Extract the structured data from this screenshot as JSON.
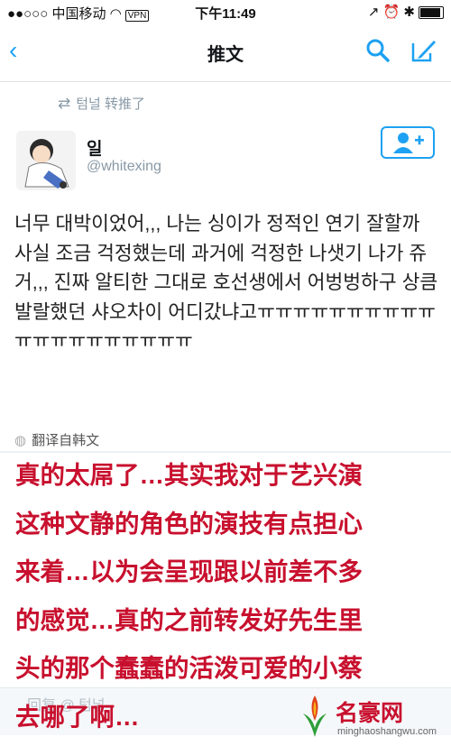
{
  "status_bar": {
    "carrier": "●●○○○ 中国移动",
    "vpn": "VPN",
    "time": "下午11:49",
    "right_icons": "↗ ⏰ ✱"
  },
  "nav": {
    "back_glyph": "‹",
    "title": "推文"
  },
  "retweet": {
    "user": "텀널",
    "action": "转推了"
  },
  "tweet": {
    "display_name": "일",
    "handle": "@whitexing",
    "text": "너무 대박이었어,,, 나는 싱이가 정적인 연기 잘할까 사실 조금 걱정했는데 과거에 걱정한 나샛기 나가 쥬거,,, 진짜 알티한 그대로 호선생에서 어벙벙하구 상큼발랄했던 샤오차이 어디갔냐고ㅠㅠㅠㅠㅠㅠㅠㅠㅠㅠㅠㅠㅠㅠㅠㅠㅠㅠㅠㅠ",
    "translate_label": "翻译自韩文"
  },
  "reply": {
    "placeholder": "回复 @ 텀널"
  },
  "overlay": {
    "lines": [
      "真的太屌了…其实我对于艺兴演",
      "这种文静的角色的演技有点担心",
      "来着…以为会呈现跟以前差不多",
      "的感觉…真的之前转发好先生里",
      "头的那个蠢蠢的活泼可爱的小蔡",
      "去哪了啊…"
    ],
    "color": "#c8102e"
  },
  "watermark": {
    "name": "名豪网",
    "url": "minghaoshangwu.com"
  },
  "colors": {
    "accent": "#1da1f2",
    "muted": "#8899a6"
  }
}
